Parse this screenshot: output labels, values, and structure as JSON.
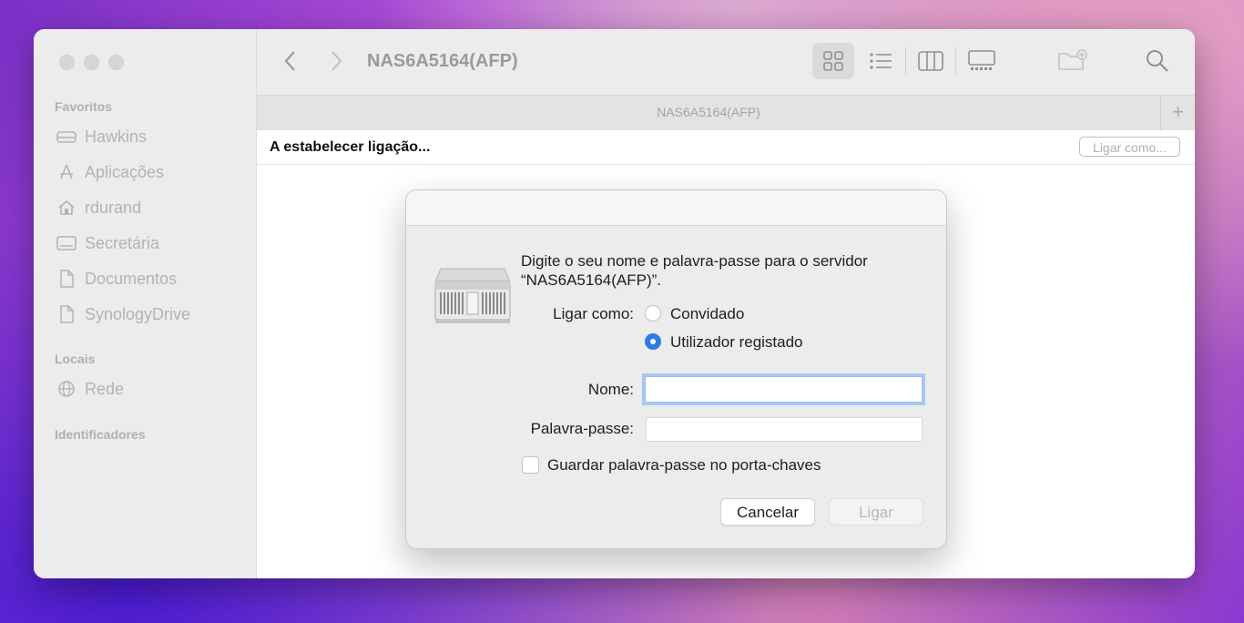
{
  "window": {
    "title": "NAS6A5164(AFP)",
    "tab_title": "NAS6A5164(AFP)",
    "tab_add": "+"
  },
  "sidebar": {
    "favorites_label": "Favoritos",
    "favorites": [
      {
        "label": "Hawkins",
        "icon": "drive-icon"
      },
      {
        "label": "Aplicações",
        "icon": "applications-icon"
      },
      {
        "label": "rdurand",
        "icon": "home-icon"
      },
      {
        "label": "Secretária",
        "icon": "desktop-icon"
      },
      {
        "label": "Documentos",
        "icon": "document-icon"
      },
      {
        "label": "SynologyDrive",
        "icon": "document-icon"
      }
    ],
    "locations_label": "Locais",
    "locations": [
      {
        "label": "Rede",
        "icon": "network-icon"
      }
    ],
    "tags_label": "Identificadores"
  },
  "status": {
    "text": "A estabelecer ligação...",
    "connect_as_button": "Ligar como..."
  },
  "dialog": {
    "prompt_line1": "Digite o seu nome e palavra-passe para o servidor",
    "prompt_line2": "“NAS6A5164(AFP)”.",
    "connect_as_label": "Ligar como:",
    "options": [
      {
        "label": "Convidado",
        "selected": false
      },
      {
        "label": "Utilizador registado",
        "selected": true
      }
    ],
    "name_label": "Nome:",
    "name_value": "",
    "password_label": "Palavra-passe:",
    "password_value": "",
    "remember_label": "Guardar palavra-passe no porta-chaves",
    "remember_checked": false,
    "cancel_button": "Cancelar",
    "connect_button": "Ligar"
  },
  "colors": {
    "accent": "#2f7ae5",
    "focus_ring": "#a9c6f5"
  }
}
